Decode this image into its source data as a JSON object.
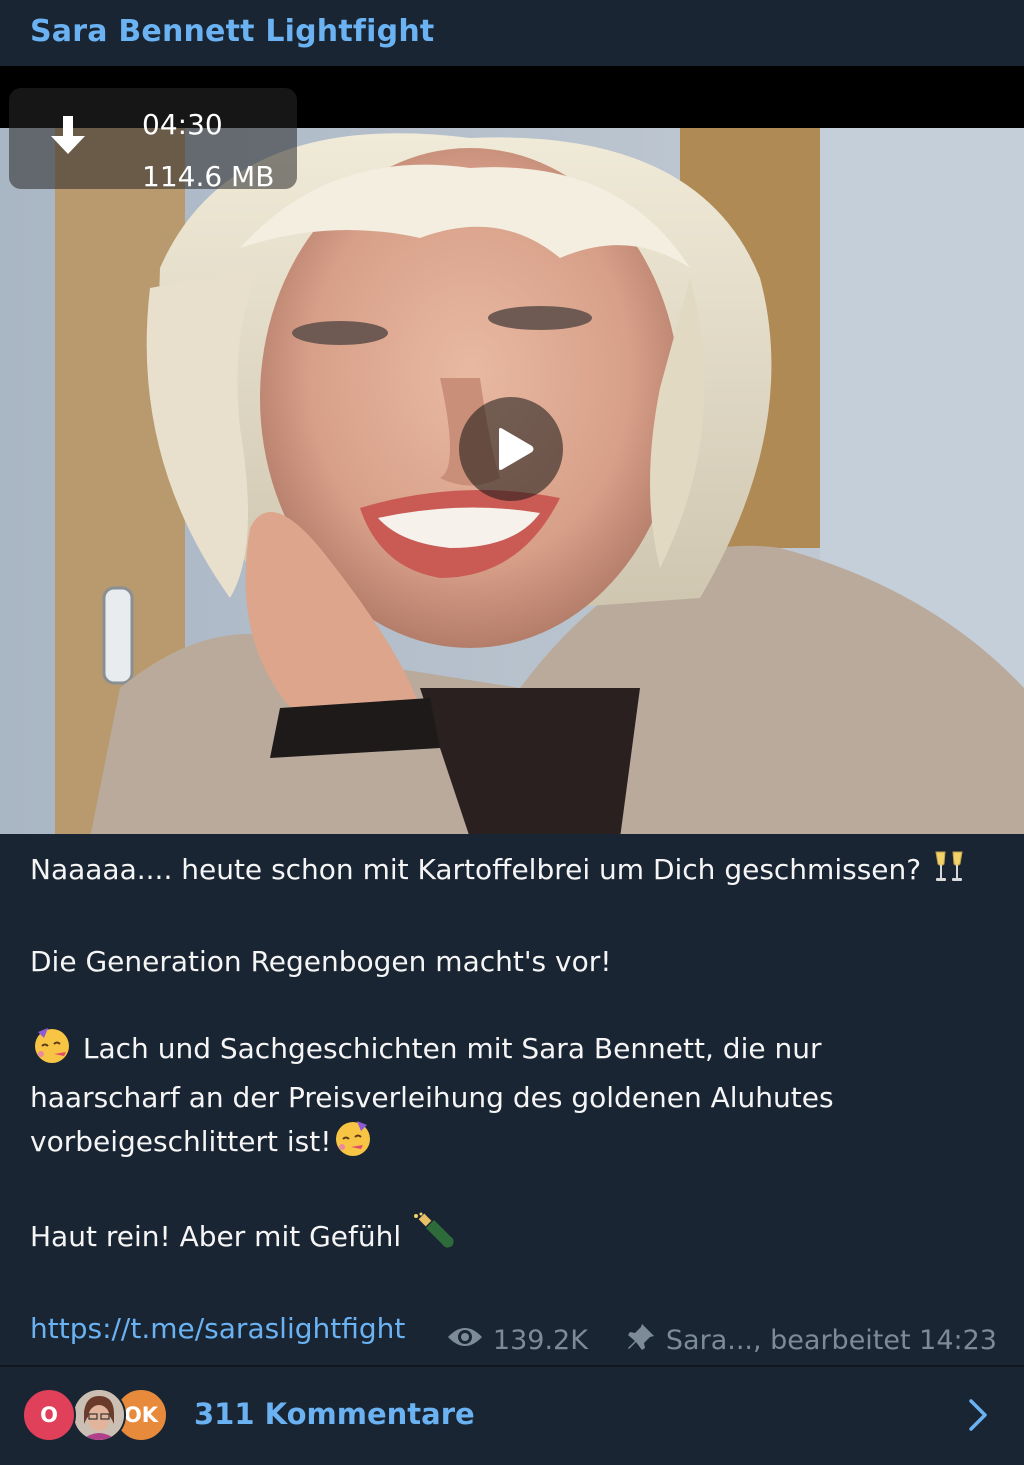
{
  "channel": {
    "name": "Sara Bennett Lightfight"
  },
  "video": {
    "duration": "04:30",
    "size": "114.6 MB"
  },
  "post": {
    "line1": "Naaaaa.... heute schon mit Kartoffelbrei um Dich geschmissen?",
    "line2": "Die Generation Regenbogen macht's vor!",
    "line3a": "Lach und Sachgeschichten mit Sara Bennett, die nur",
    "line3b": "haarscharf an der Preisverleihung des goldenen Aluhutes",
    "line3c": "vorbeigeschlittert ist!",
    "line4": "Haut rein! Aber mit Gefühl",
    "link": "https://t.me/saraslightfight"
  },
  "meta": {
    "views": "139.2K",
    "signature": "Sara..., bearbeitet 14:23"
  },
  "comments": {
    "label": "311 Kommentare",
    "avatars": [
      "O",
      "",
      "OK"
    ]
  },
  "colors": {
    "accent": "#6ab2f2",
    "background": "#1a2533",
    "muted": "#7d8b99"
  },
  "icons": [
    "download-icon",
    "play-icon",
    "clinking-glasses-emoji",
    "partying-face-emoji",
    "champagne-emoji",
    "eye-icon",
    "pin-icon",
    "chevron-right-icon"
  ]
}
